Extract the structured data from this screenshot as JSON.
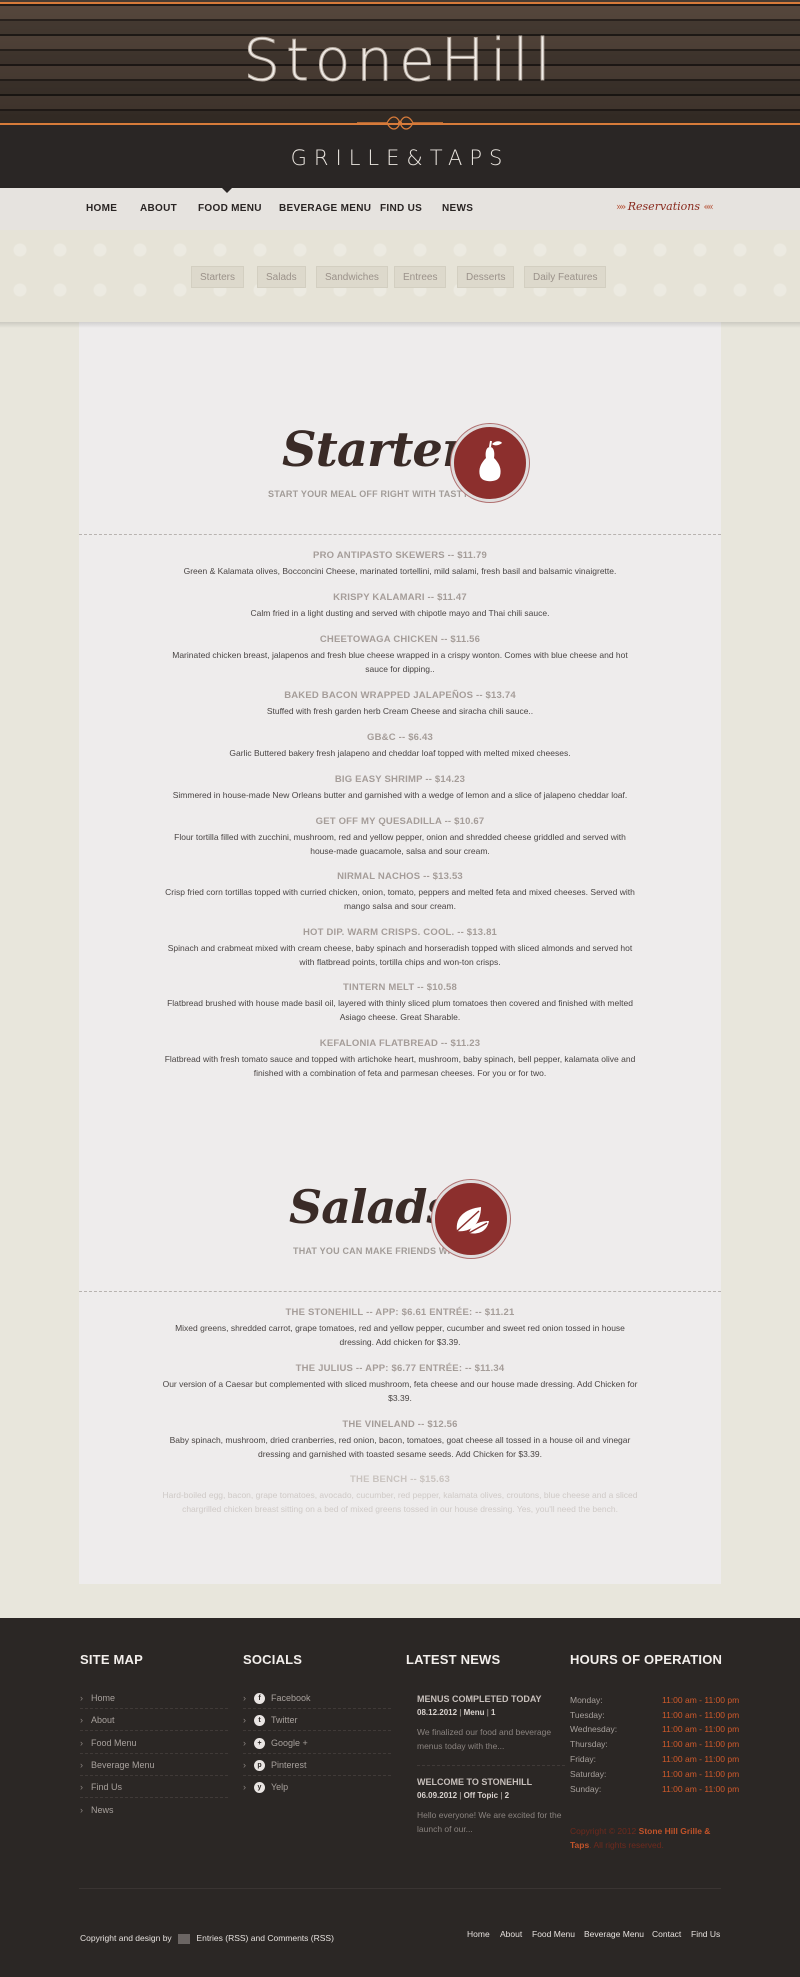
{
  "brand": {
    "title": "StoneHill",
    "subtitle": "GRILLE&TAPS"
  },
  "nav": {
    "items": [
      "HOME",
      "ABOUT",
      "FOOD MENU",
      "BEVERAGE MENU",
      "FIND US",
      "NEWS"
    ],
    "active": "FOOD MENU",
    "reservations_label": "Reservations"
  },
  "subnav": [
    "Starters",
    "Salads",
    "Sandwiches",
    "Entrees",
    "Desserts",
    "Daily Features"
  ],
  "sections": [
    {
      "title": "Starters",
      "tagline": "START YOUR MEAL OFF RIGHT WITH TASTY APPS",
      "icon": "pear-icon",
      "items": [
        {
          "name": "PRO ANTIPASTO SKEWERS -- $11.79",
          "desc": "Green & Kalamata olives, Bocconcini Cheese, marinated tortellini, mild salami, fresh basil and balsamic vinaigrette."
        },
        {
          "name": "KRISPY KALAMARI -- $11.47",
          "desc": "Calm fried in a light dusting and served with chipotle mayo and Thai chili sauce."
        },
        {
          "name": "CHEETOWAGA CHICKEN -- $11.56",
          "desc": "Marinated chicken breast, jalapenos and fresh blue cheese wrapped in a crispy wonton. Comes with blue cheese and hot sauce for dipping.."
        },
        {
          "name": "BAKED BACON WRAPPED JALAPEÑOS -- $13.74",
          "desc": "Stuffed with fresh garden herb Cream Cheese and siracha chili sauce.."
        },
        {
          "name": "GB&C -- $6.43",
          "desc": "Garlic Buttered bakery fresh jalapeno and cheddar loaf topped with melted mixed cheeses."
        },
        {
          "name": "BIG EASY SHRIMP -- $14.23",
          "desc": "Simmered in house-made New Orleans butter and garnished with a wedge of lemon and a slice of jalapeno cheddar loaf."
        },
        {
          "name": "GET OFF MY QUESADILLA -- $10.67",
          "desc": "Flour tortilla filled with zucchini, mushroom, red and yellow pepper, onion and shredded cheese griddled and served with house-made guacamole, salsa and sour cream."
        },
        {
          "name": "NIRMAL NACHOS -- $13.53",
          "desc": "Crisp fried corn tortillas topped with curried chicken, onion, tomato, peppers and melted feta and mixed cheeses. Served with mango salsa and sour cream."
        },
        {
          "name": "HOT DIP. WARM CRISPS. COOL. -- $13.81",
          "desc": "Spinach and crabmeat mixed with cream cheese, baby spinach and horseradish topped with sliced almonds and served hot with flatbread points, tortilla chips and won-ton crisps."
        },
        {
          "name": "TINTERN MELT -- $10.58",
          "desc": "Flatbread brushed with house made basil oil, layered with thinly sliced plum tomatoes then covered and finished with melted Asiago cheese. Great Sharable."
        },
        {
          "name": "KEFALONIA FLATBREAD -- $11.23",
          "desc": "Flatbread with fresh tomato sauce and topped with artichoke heart, mushroom, baby spinach, bell pepper, kalamata olive and finished with a combination of feta and parmesan cheeses. For you or for two."
        }
      ]
    },
    {
      "title": "Salads",
      "tagline": "THAT YOU CAN MAKE FRIENDS WITH",
      "icon": "leaves-icon",
      "items": [
        {
          "name": "THE STONEHILL -- APP: $6.61 ENTRÉE: -- $11.21",
          "desc": "Mixed greens, shredded carrot, grape tomatoes, red and yellow pepper, cucumber and sweet red onion tossed in house dressing. Add chicken for $3.39."
        },
        {
          "name": "THE JULIUS -- APP: $6.77 ENTRÉE: -- $11.34",
          "desc": "Our version of a Caesar but complemented with sliced mushroom, feta cheese and our house made dressing. Add Chicken for $3.39."
        },
        {
          "name": "THE VINELAND -- $12.56",
          "desc": "Baby spinach, mushroom, dried cranberries, red onion, bacon, tomatoes, goat cheese all tossed in a house oil and vinegar dressing and garnished with toasted sesame seeds. Add Chicken for $3.39."
        },
        {
          "name": "THE BENCH -- $15.63",
          "desc": "Hard-boiled egg, bacon, grape tomatoes, avocado, cucumber, red pepper, kalamata olives, croutons, blue cheese and a sliced chargrilled chicken breast sitting on a bed of mixed greens tossed in our house dressing. Yes, you'll need the bench."
        }
      ]
    }
  ],
  "footer": {
    "sitemap": {
      "heading": "SITE MAP",
      "links": [
        "Home",
        "About",
        "Food Menu",
        "Beverage Menu",
        "Find Us",
        "News"
      ]
    },
    "socials": {
      "heading": "SOCIALS",
      "links": [
        {
          "label": "Facebook",
          "icon": "facebook-icon",
          "glyph": "f"
        },
        {
          "label": "Twitter",
          "icon": "twitter-icon",
          "glyph": "t"
        },
        {
          "label": "Google +",
          "icon": "google-plus-icon",
          "glyph": "+"
        },
        {
          "label": "Pinterest",
          "icon": "pinterest-icon",
          "glyph": "p"
        },
        {
          "label": "Yelp",
          "icon": "yelp-icon",
          "glyph": "y"
        }
      ]
    },
    "news": {
      "heading": "LATEST NEWS",
      "posts": [
        {
          "title": "MENUS COMPLETED TODAY",
          "date": "08.12.2012",
          "category": "Menu",
          "comments": "1",
          "excerpt": "We finalized our food and beverage menus today with the..."
        },
        {
          "title": "WELCOME TO STONEHILL",
          "date": "06.09.2012",
          "category": "Off Topic",
          "comments": "2",
          "excerpt": "Hello everyone! We are excited for the launch of our..."
        }
      ]
    },
    "hours": {
      "heading": "HOURS OF OPERATION",
      "rows": [
        {
          "day": "Monday:",
          "time": "11:00 am - 11:00 pm"
        },
        {
          "day": "Tuesday:",
          "time": "11:00 am - 11:00 pm"
        },
        {
          "day": "Wednesday:",
          "time": "11:00 am - 11:00 pm"
        },
        {
          "day": "Thursday:",
          "time": "11:00 am - 11:00 pm"
        },
        {
          "day": "Friday:",
          "time": "11:00 am - 11:00 pm"
        },
        {
          "day": "Saturday:",
          "time": "11:00 am - 11:00 pm"
        },
        {
          "day": "Sunday:",
          "time": "11:00 am - 11:00 pm"
        }
      ]
    },
    "copyright_prefix": "Copyright © 2012",
    "copyright_name": "Stone Hill Grille & Taps",
    "copyright_suffix": ". All rights reserved.",
    "credit": {
      "prefix": "Copyright and design by",
      "entries": "Entries (RSS)",
      "and": "and",
      "comments": "Comments (RSS)"
    },
    "bottom_links": [
      "Home",
      "About",
      "Food Menu",
      "Beverage Menu",
      "Contact",
      "Find Us"
    ]
  },
  "colors": {
    "accent": "#d77b3a",
    "badge": "#8c2f2d",
    "hours": "#d05a2b",
    "footer_bg": "#2b2725"
  }
}
